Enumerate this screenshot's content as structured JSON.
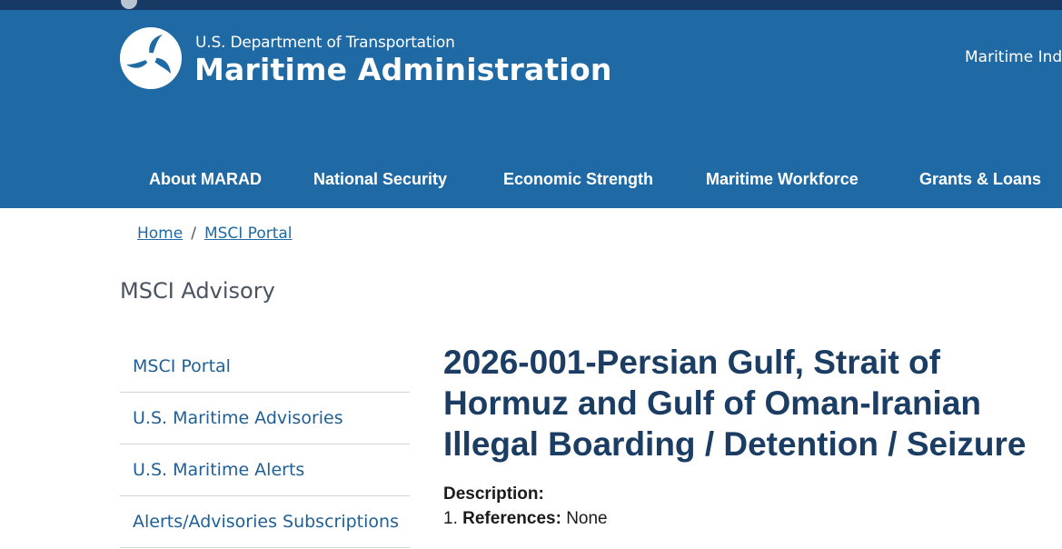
{
  "header": {
    "agency_small": "U.S. Department of Transportation",
    "agency_name": "Maritime Administration",
    "utility_link": "Maritime Indu",
    "colors": {
      "header_bg": "#1f6aa5",
      "top_strip": "#163a63"
    }
  },
  "nav": {
    "items": [
      {
        "label": "About MARAD"
      },
      {
        "label": "National Security"
      },
      {
        "label": "Economic Strength"
      },
      {
        "label": "Maritime Workforce"
      },
      {
        "label": "Grants & Loans"
      }
    ]
  },
  "breadcrumb": {
    "home": "Home",
    "separator": "/",
    "current": "MSCI Portal"
  },
  "sidebar": {
    "title": "MSCI Advisory",
    "items": [
      {
        "label": "MSCI Portal"
      },
      {
        "label": "U.S. Maritime Advisories"
      },
      {
        "label": "U.S. Maritime Alerts"
      },
      {
        "label": "Alerts/Advisories Subscriptions"
      }
    ]
  },
  "content": {
    "title": "2026-001-Persian Gulf, Strait of Hormuz and Gulf of Oman-Iranian Illegal Boarding / Detention / Seizure",
    "description_label": "Description:",
    "references_number": "1.",
    "references_label": "References:",
    "references_value": "None"
  },
  "icons": {
    "logo": "dot-triskelion-logo-icon"
  }
}
